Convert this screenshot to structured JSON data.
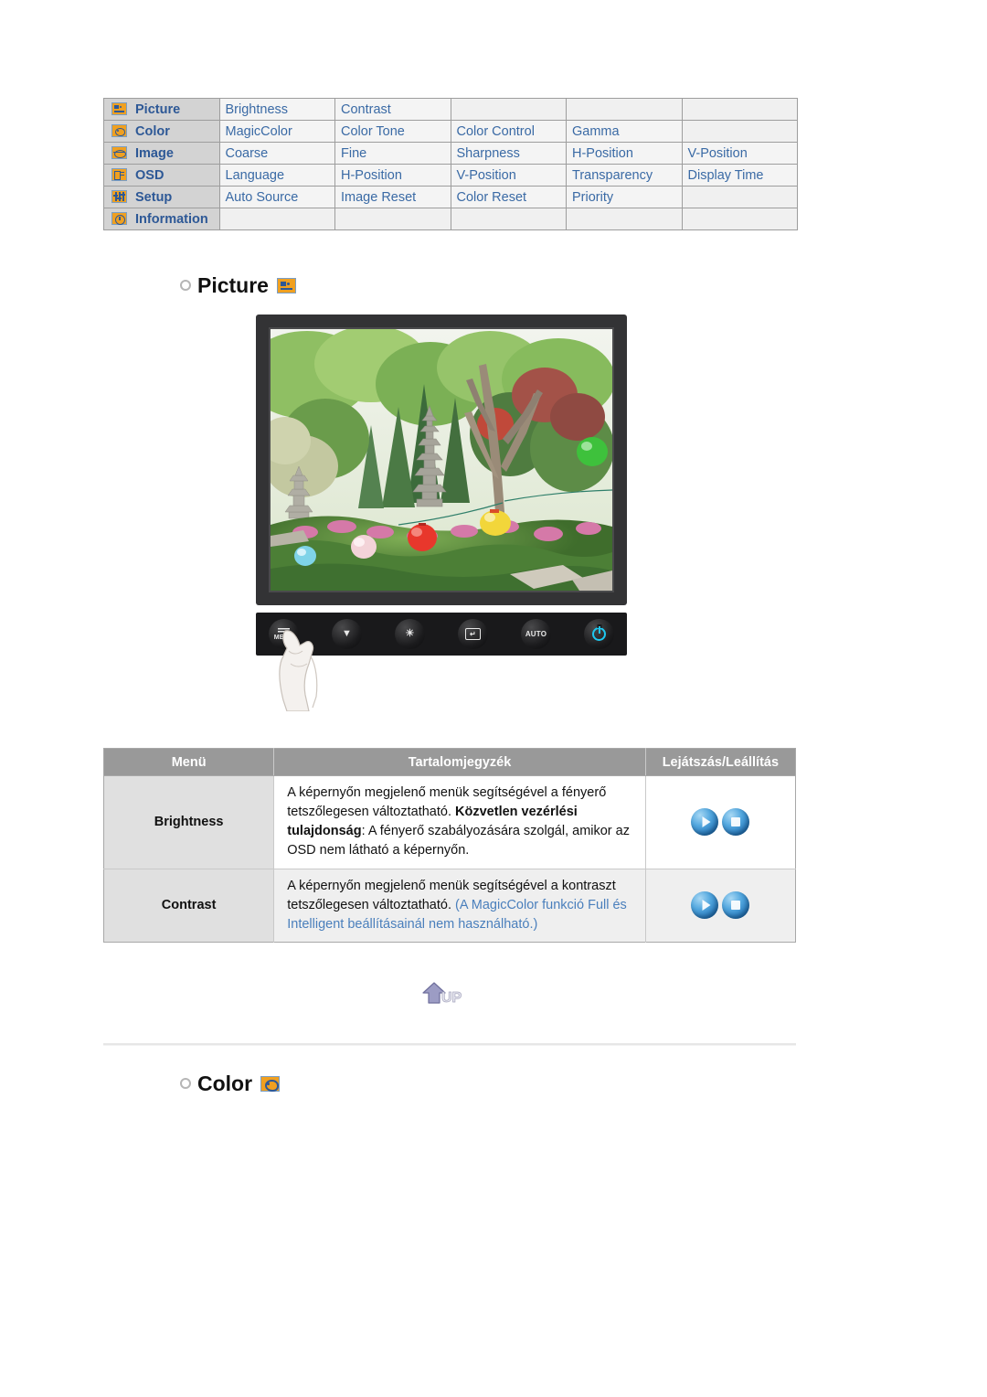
{
  "nav_table": {
    "rows": [
      {
        "icon": "picture-icon",
        "menu": "Picture",
        "items": [
          "Brightness",
          "Contrast",
          "",
          "",
          ""
        ]
      },
      {
        "icon": "color-icon",
        "menu": "Color",
        "items": [
          "MagicColor",
          "Color Tone",
          "Color Control",
          "Gamma",
          ""
        ]
      },
      {
        "icon": "image-icon",
        "menu": "Image",
        "items": [
          "Coarse",
          "Fine",
          "Sharpness",
          "H-Position",
          "V-Position"
        ]
      },
      {
        "icon": "osd-icon",
        "menu": "OSD",
        "items": [
          "Language",
          "H-Position",
          "V-Position",
          "Transparency",
          "Display Time"
        ]
      },
      {
        "icon": "setup-icon",
        "menu": "Setup",
        "items": [
          "Auto Source",
          "Image Reset",
          "Color Reset",
          "Priority",
          ""
        ]
      },
      {
        "icon": "information-icon",
        "menu": "Information",
        "items": [
          "",
          "",
          "",
          "",
          ""
        ]
      }
    ]
  },
  "sections": {
    "picture": {
      "title": "Picture",
      "icon": "picture-icon"
    },
    "color": {
      "title": "Color",
      "icon": "color-icon"
    }
  },
  "monitor": {
    "buttons": [
      {
        "name": "menu-button",
        "label": "MENU"
      },
      {
        "name": "source-down-button",
        "label": "▼"
      },
      {
        "name": "brightness-button",
        "label": "☀"
      },
      {
        "name": "enter-button",
        "label": "↵"
      },
      {
        "name": "auto-button",
        "label": "AUTO"
      },
      {
        "name": "power-button",
        "label": ""
      }
    ],
    "power_color": "#1ec8f0"
  },
  "spec_table": {
    "headers": [
      "Menü",
      "Tartalomjegyzék",
      "Lejátszás/Leállítás"
    ],
    "rows": [
      {
        "menu": "Brightness",
        "desc_line1": "A képernyőn megjelenő menük segítségével a fényerő tetszőlegesen változtatható.",
        "desc_bold": "Közvetlen vezérlési tulajdonság",
        "desc_line2": ": A fényerő szabályozására szolgál, amikor az OSD nem látható a képernyőn.",
        "desc_note": "",
        "play_label": "play-orb",
        "stop_label": "stop-orb"
      },
      {
        "menu": "Contrast",
        "desc_line1": "A képernyőn megjelenő menük segítségével a kontraszt tetszőlegesen változtatható.",
        "desc_bold": "",
        "desc_line2": "",
        "desc_note": "(A MagicColor funkció Full és Intelligent beállításainál nem használható.)",
        "play_label": "play-orb",
        "stop_label": "stop-orb"
      }
    ]
  },
  "up_button": {
    "label": "UP",
    "icon": "up-arrow-icon"
  },
  "colors": {
    "link_blue": "#3a6aa5",
    "menu_blue": "#2d5896",
    "icon_orange": "#f0a020",
    "header_gray": "#999999",
    "note_blue": "#4a7fbc"
  }
}
